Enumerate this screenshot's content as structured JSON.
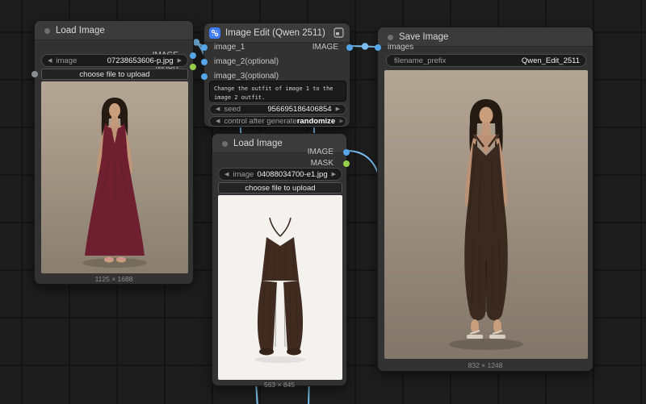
{
  "colors": {
    "link_blue": "#7cc0f0",
    "port_blue": "#55a6e8",
    "port_green": "#97cf4c",
    "header_icon_blue": "#3f7cf6"
  },
  "nodes": {
    "load_image_1": {
      "title": "Load Image",
      "outputs": {
        "image": "IMAGE",
        "mask": "MASK"
      },
      "image_widget": {
        "label": "image",
        "value": "07238653606-p.jpg"
      },
      "upload_label": "choose file to upload",
      "caption": "1125 × 1688"
    },
    "image_edit": {
      "title": "Image Edit (Qwen 2511)",
      "inputs": [
        "image_1",
        "image_2(optional)",
        "image_3(optional)"
      ],
      "output": "IMAGE",
      "prompt": "Change the outfit of image 1 to the image 2 outfit.",
      "seed": {
        "label": "seed",
        "value": "956695186406854"
      },
      "control": {
        "label": "control after generate",
        "value": "randomize"
      }
    },
    "load_image_2": {
      "title": "Load Image",
      "outputs": {
        "image": "IMAGE",
        "mask": "MASK"
      },
      "image_widget": {
        "label": "image",
        "value": "04088034700-e1.jpg"
      },
      "upload_label": "choose file to upload",
      "caption": "563 × 845"
    },
    "save_image": {
      "title": "Save Image",
      "input": "images",
      "filename_widget": {
        "label": "filename_prefix",
        "value": "Qwen_Edit_2511"
      },
      "caption": "832 × 1248"
    }
  }
}
